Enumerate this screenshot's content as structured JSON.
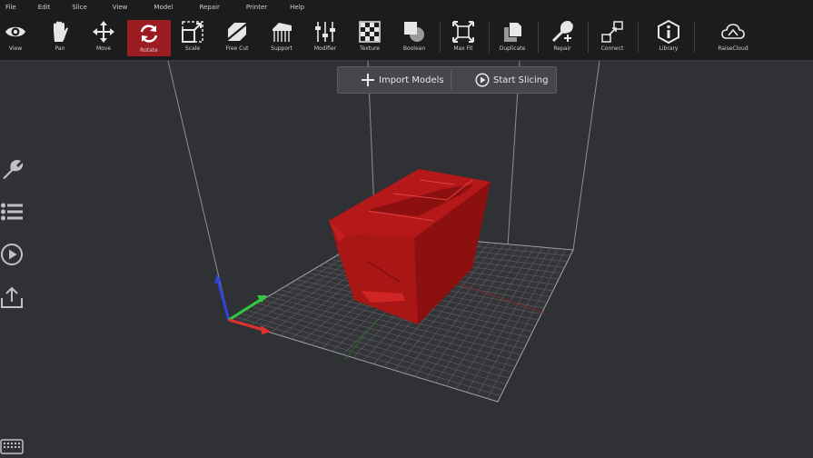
{
  "menu": [
    "File",
    "Edit",
    "Slice",
    "View",
    "Model",
    "Repair",
    "Printer",
    "Help"
  ],
  "toolbar": {
    "tools": [
      {
        "label": "View",
        "icon": "eye-icon"
      },
      {
        "label": "Pan",
        "icon": "hand-icon"
      },
      {
        "label": "Move",
        "icon": "move-arrows-icon"
      },
      {
        "label": "Rotate",
        "icon": "rotate-icon",
        "active": true
      },
      {
        "label": "Scale",
        "icon": "scale-icon"
      },
      {
        "label": "Free Cut",
        "icon": "free-cut-icon"
      },
      {
        "label": "Support",
        "icon": "support-icon"
      },
      {
        "label": "Modifier",
        "icon": "modifier-sliders-icon"
      },
      {
        "label": "Texture",
        "icon": "texture-checker-icon"
      },
      {
        "label": "Boolean",
        "icon": "boolean-icon"
      },
      {
        "label": "Max Fit",
        "icon": "max-fit-icon"
      },
      {
        "label": "Duplicate",
        "icon": "duplicate-icon"
      },
      {
        "label": "Repair",
        "icon": "repair-wrench-icon"
      },
      {
        "label": "Connect",
        "icon": "connect-icon"
      },
      {
        "label": "Library",
        "icon": "library-info-icon"
      },
      {
        "label": "RaiseCloud",
        "icon": "raisecloud-icon"
      }
    ]
  },
  "actions": {
    "import_label": "Import Models",
    "slice_label": "Start Slicing"
  },
  "sidebar": [
    "wrench-icon",
    "list-icon",
    "play-circle-icon",
    "export-icon"
  ],
  "colors": {
    "background": "#2f3134",
    "toolbar": "#1b1c1e",
    "accent": "#9b1d21",
    "model": "#b01414"
  }
}
